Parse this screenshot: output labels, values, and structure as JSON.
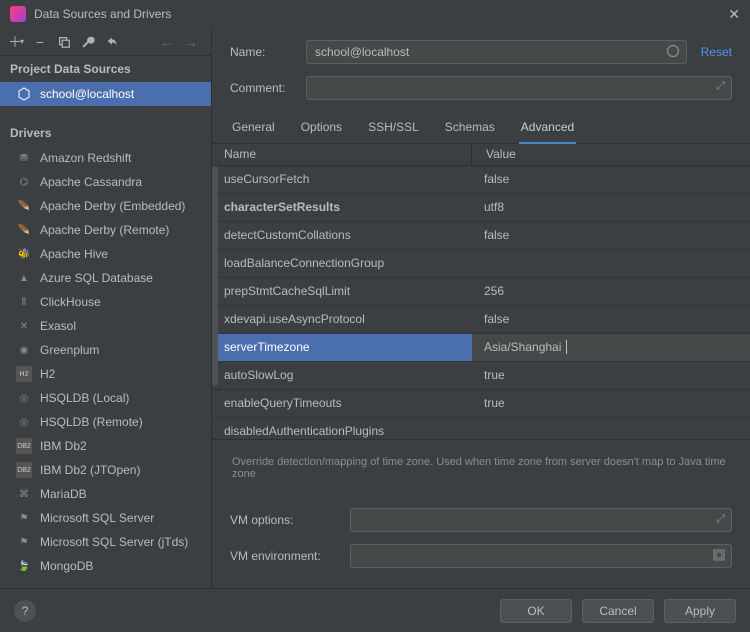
{
  "window": {
    "title": "Data Sources and Drivers"
  },
  "sidebar": {
    "section_sources": "Project Data Sources",
    "sources": [
      {
        "label": "school@localhost",
        "selected": true
      }
    ],
    "section_drivers": "Drivers",
    "drivers": [
      {
        "label": "Amazon Redshift"
      },
      {
        "label": "Apache Cassandra"
      },
      {
        "label": "Apache Derby (Embedded)"
      },
      {
        "label": "Apache Derby (Remote)"
      },
      {
        "label": "Apache Hive"
      },
      {
        "label": "Azure SQL Database"
      },
      {
        "label": "ClickHouse"
      },
      {
        "label": "Exasol"
      },
      {
        "label": "Greenplum"
      },
      {
        "label": "H2"
      },
      {
        "label": "HSQLDB (Local)"
      },
      {
        "label": "HSQLDB (Remote)"
      },
      {
        "label": "IBM Db2"
      },
      {
        "label": "IBM Db2 (JTOpen)"
      },
      {
        "label": "MariaDB"
      },
      {
        "label": "Microsoft SQL Server"
      },
      {
        "label": "Microsoft SQL Server (jTds)"
      },
      {
        "label": "MongoDB"
      }
    ]
  },
  "form": {
    "name_label": "Name:",
    "name_value": "school@localhost",
    "comment_label": "Comment:",
    "comment_value": "",
    "reset": "Reset"
  },
  "tabs": [
    {
      "label": "General"
    },
    {
      "label": "Options"
    },
    {
      "label": "SSH/SSL"
    },
    {
      "label": "Schemas"
    },
    {
      "label": "Advanced",
      "active": true
    }
  ],
  "table": {
    "col_name": "Name",
    "col_value": "Value",
    "rows": [
      {
        "name": "useCursorFetch",
        "value": "false"
      },
      {
        "name": "characterSetResults",
        "value": "utf8",
        "bold": true
      },
      {
        "name": "detectCustomCollations",
        "value": "false"
      },
      {
        "name": "loadBalanceConnectionGroup",
        "value": ""
      },
      {
        "name": "prepStmtCacheSqlLimit",
        "value": "256"
      },
      {
        "name": "xdevapi.useAsyncProtocol",
        "value": "false"
      },
      {
        "name": "serverTimezone",
        "value": "Asia/Shanghai",
        "selected": true
      },
      {
        "name": "autoSlowLog",
        "value": "true"
      },
      {
        "name": "enableQueryTimeouts",
        "value": "true"
      },
      {
        "name": "disabledAuthenticationPlugins",
        "value": ""
      }
    ]
  },
  "hint": "Override detection/mapping of time zone. Used when time zone from server doesn't map to Java time zone",
  "vm": {
    "options_label": "VM options:",
    "environment_label": "VM environment:"
  },
  "footer": {
    "ok": "OK",
    "cancel": "Cancel",
    "apply": "Apply"
  }
}
